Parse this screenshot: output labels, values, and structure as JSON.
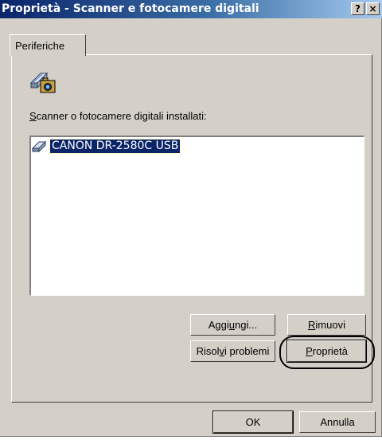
{
  "window": {
    "title": "Proprietà - Scanner e fotocamere digitali",
    "help_label": "?",
    "close_label": "×"
  },
  "tabs": [
    {
      "label": "Periferiche"
    }
  ],
  "section": {
    "label_first": "S",
    "label_rest": "canner o fotocamere digitali installati:"
  },
  "devices": [
    {
      "name": "CANON DR-2580C USB",
      "icon": "scanner-icon",
      "selected": true
    }
  ],
  "buttons": {
    "add": {
      "pre": "Aggi",
      "accel": "u",
      "post": "ngi..."
    },
    "remove": {
      "pre": "",
      "accel": "R",
      "post": "imuovi"
    },
    "troubleshoot": {
      "pre": "Risol",
      "accel": "v",
      "post": "i problemi"
    },
    "properties": {
      "pre": "",
      "accel": "P",
      "post": "roprietà"
    },
    "ok": "OK",
    "cancel": "Annulla"
  },
  "colors": {
    "title_start": "#0a246a",
    "title_end": "#a6caf0",
    "face": "#d4d0c8",
    "selection": "#0a246a"
  }
}
